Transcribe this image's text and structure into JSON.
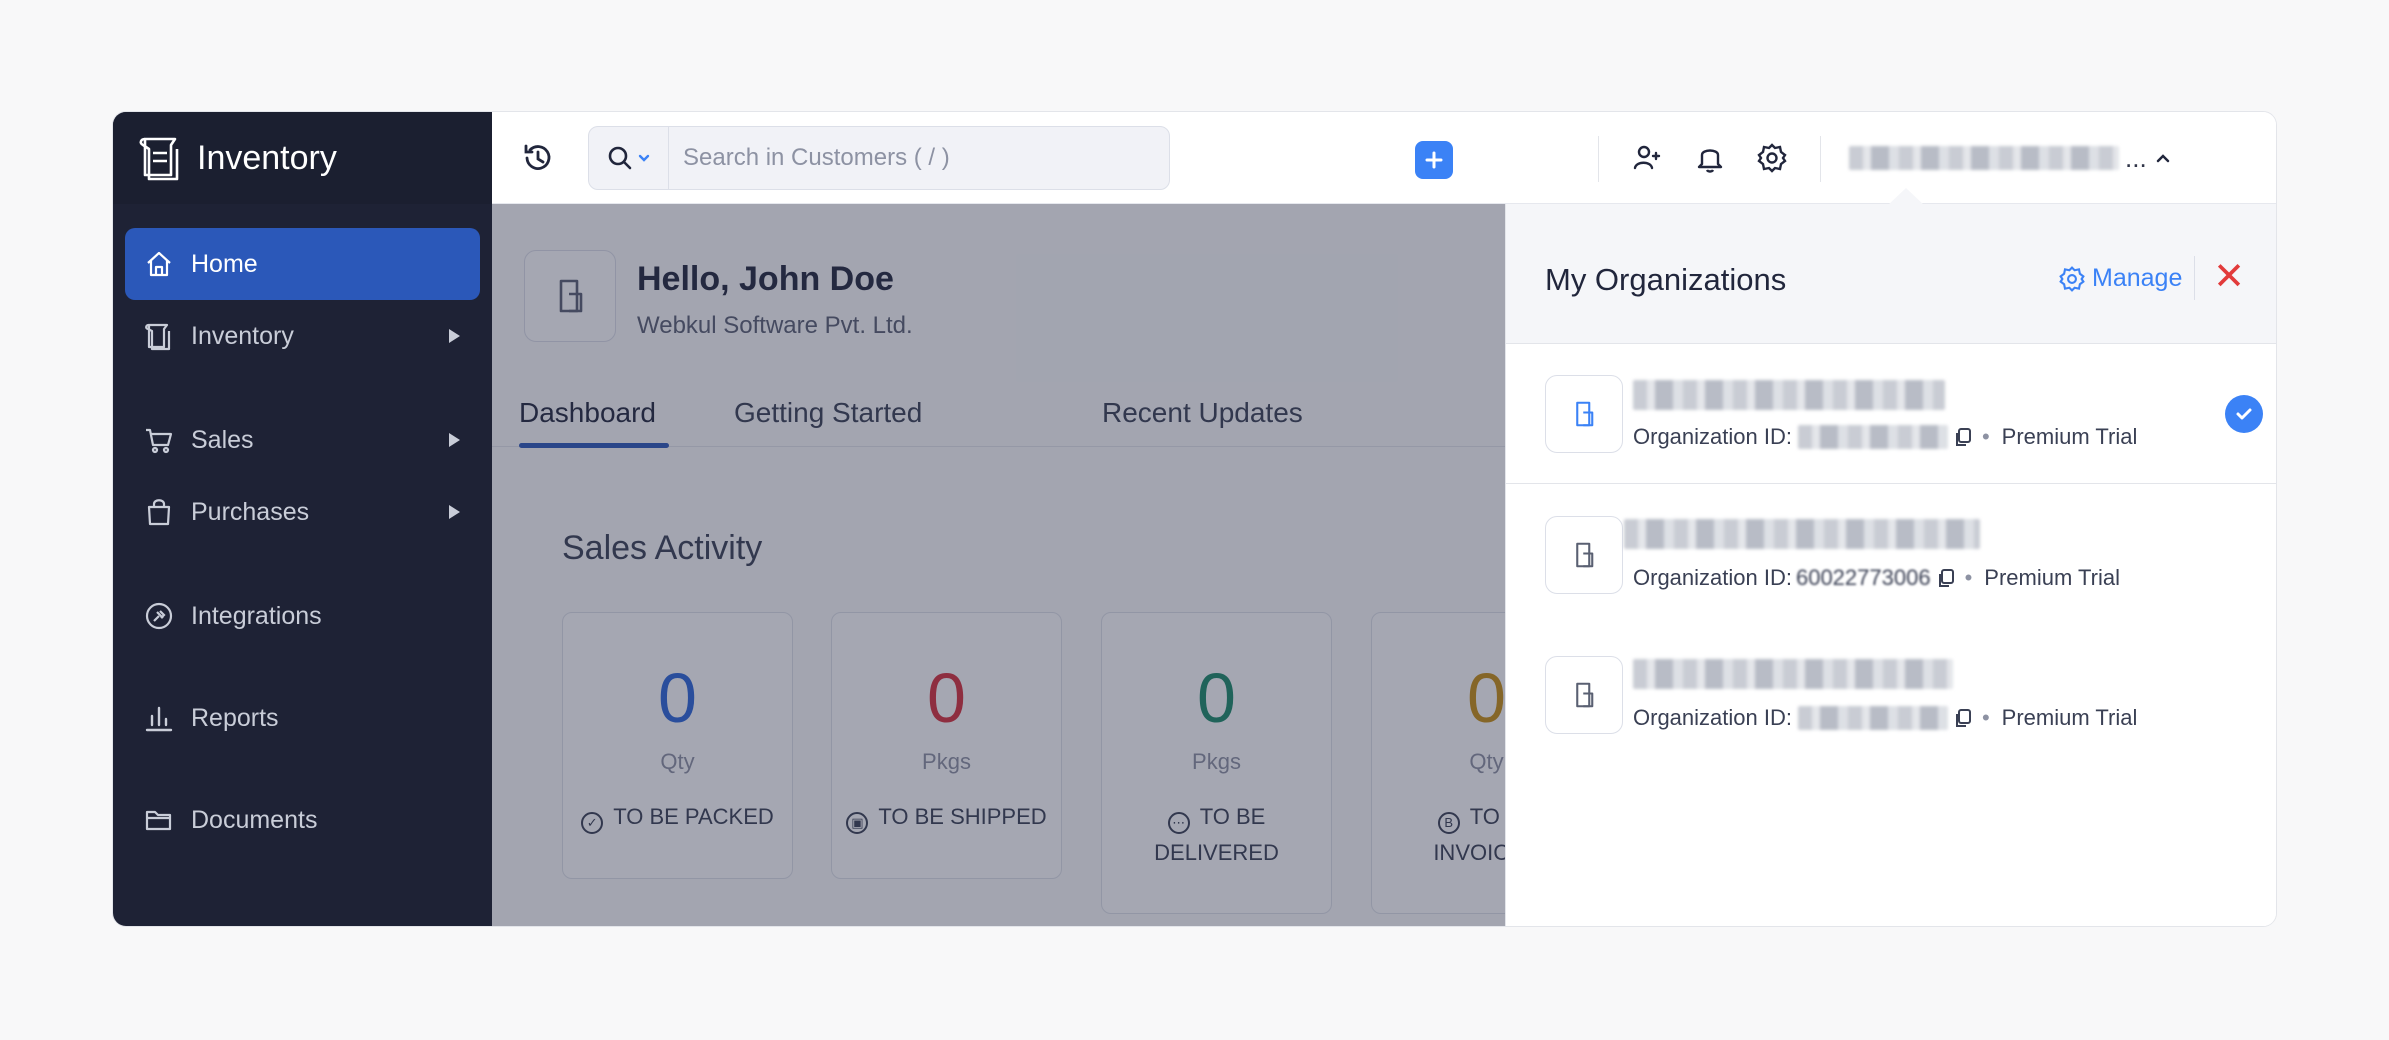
{
  "app": {
    "name": "Inventory"
  },
  "sidebar": {
    "items": [
      {
        "label": "Home",
        "icon": "home-icon",
        "active": true
      },
      {
        "label": "Inventory",
        "icon": "inventory-icon",
        "has_submenu": true
      },
      {
        "label": "Sales",
        "icon": "cart-icon",
        "has_submenu": true
      },
      {
        "label": "Purchases",
        "icon": "bag-icon",
        "has_submenu": true
      },
      {
        "label": "Integrations",
        "icon": "integrations-icon"
      },
      {
        "label": "Reports",
        "icon": "reports-icon"
      },
      {
        "label": "Documents",
        "icon": "folder-icon"
      }
    ]
  },
  "topbar": {
    "search_placeholder": "Search in Customers ( / )",
    "org_switch_label": "...",
    "accent": "#3b82f6"
  },
  "main": {
    "greeting": "Hello, John Doe",
    "company": "Webkul Software Pvt. Ltd.",
    "tabs": [
      {
        "label": "Dashboard",
        "active": true
      },
      {
        "label": "Getting Started"
      },
      {
        "label": "Recent Updates"
      }
    ],
    "sales_activity": {
      "title": "Sales Activity",
      "cards": [
        {
          "value": "0",
          "unit": "Qty",
          "label": "TO BE PACKED",
          "color": "#2b66d9"
        },
        {
          "value": "0",
          "unit": "Pkgs",
          "label": "TO BE SHIPPED",
          "color": "#d8303c"
        },
        {
          "value": "0",
          "unit": "Pkgs",
          "label": "TO BE DELIVERED",
          "color": "#1a8a68"
        },
        {
          "value": "0",
          "unit": "Qty",
          "label": "TO BE INVOICED",
          "color": "#c98f12"
        }
      ]
    }
  },
  "organizations_panel": {
    "title": "My Organizations",
    "manage_label": "Manage",
    "close_label": "✕",
    "orgs": [
      {
        "id_label": "Organization ID:",
        "plan": "Premium Trial",
        "selected": true
      },
      {
        "id_label": "Organization ID:",
        "id_value": "60022773006",
        "plan": "Premium Trial",
        "selected": false
      },
      {
        "id_label": "Organization ID:",
        "plan": "Premium Trial",
        "selected": false
      }
    ]
  }
}
